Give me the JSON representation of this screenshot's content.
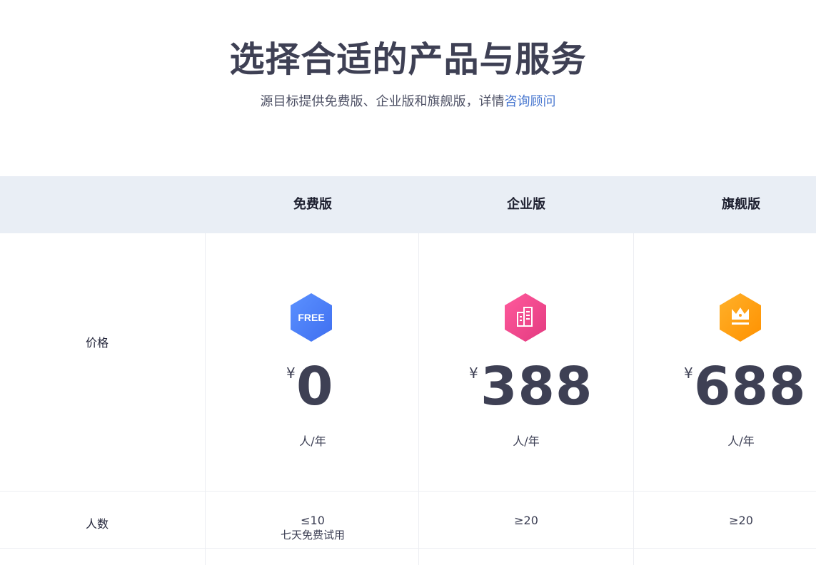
{
  "hero": {
    "title": "选择合适的产品与服务",
    "subtitle_prefix": "源目标提供免费版、企业版和旗舰版，详情",
    "subtitle_link": "咨询顾问"
  },
  "plans_table": {
    "header": {
      "plans": [
        "免费版",
        "企业版",
        "旗舰版"
      ]
    },
    "price_row": {
      "label": "价格",
      "items": [
        {
          "icon": "free-badge-icon",
          "currency": "¥",
          "amount": "0",
          "unit": "人/年"
        },
        {
          "icon": "building-badge-icon",
          "currency": "¥",
          "amount": "388",
          "unit": "人/年"
        },
        {
          "icon": "crown-badge-icon",
          "currency": "¥",
          "amount": "688",
          "unit": "人/年"
        }
      ],
      "badge_text_free": "FREE"
    },
    "people_row": {
      "label": "人数",
      "items": [
        {
          "value": "≤10",
          "note": "七天免费试用"
        },
        {
          "value": "≥20",
          "note": ""
        },
        {
          "value": "≥20",
          "note": ""
        }
      ]
    }
  },
  "colors": {
    "title": "#3e4054",
    "link": "#4a78d0",
    "header_bg": "#e9eef5",
    "free_badge": "#4b7ef2",
    "enterprise_badge": "#f0458d",
    "flagship_badge": "#ff9f1a"
  }
}
